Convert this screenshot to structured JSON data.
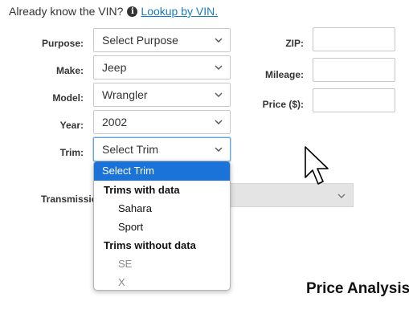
{
  "vin_prompt": {
    "text": "Already know the VIN?",
    "icon": "info-icon",
    "link_label": "Lookup by VIN."
  },
  "form": {
    "purpose": {
      "label": "Purpose:",
      "value": "Select Purpose"
    },
    "make": {
      "label": "Make:",
      "value": "Jeep"
    },
    "model": {
      "label": "Model:",
      "value": "Wrangler"
    },
    "year": {
      "label": "Year:",
      "value": "2002"
    },
    "trim": {
      "label": "Trim:",
      "value": "Select Trim"
    },
    "transmission": {
      "label": "Transmissio",
      "value": ""
    },
    "zip": {
      "label": "ZIP:",
      "value": ""
    },
    "mileage": {
      "label": "Mileage:",
      "value": ""
    },
    "price": {
      "label": "Price ($):",
      "value": ""
    }
  },
  "trim_dropdown": {
    "selected_option": "Select Trim",
    "groups": [
      {
        "label": "Trims with data",
        "options": [
          "Sahara",
          "Sport"
        ]
      },
      {
        "label": "Trims without data",
        "options": [
          "SE",
          "X"
        ]
      }
    ]
  },
  "section_heading": "Price Analysis",
  "colors": {
    "link": "#1a7bbf",
    "selected_option_bg": "#1a73d9",
    "disabled_option_text": "#8c8c8c"
  }
}
